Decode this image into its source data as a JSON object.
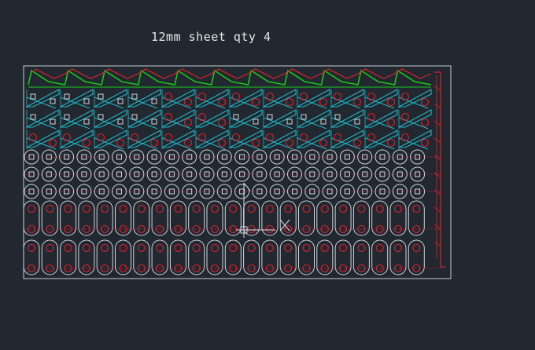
{
  "drawing": {
    "title": "12mm sheet qty 4"
  },
  "colors": {
    "background": "#212830",
    "sheet_outline": "#c8ccd4",
    "part_outline": "#d0d4dc",
    "hole": "#e0202c",
    "wedge": "#20b8c8",
    "edge_strip": "#18c818",
    "edge_trim": "#e0202c",
    "cursor": "#d8dce4"
  },
  "layout_grid": {
    "wedge_rows": 3,
    "wedge_cols": 12,
    "round_rows": 3,
    "round_cols": 23,
    "link_rows": 2,
    "link_cols": 22
  }
}
